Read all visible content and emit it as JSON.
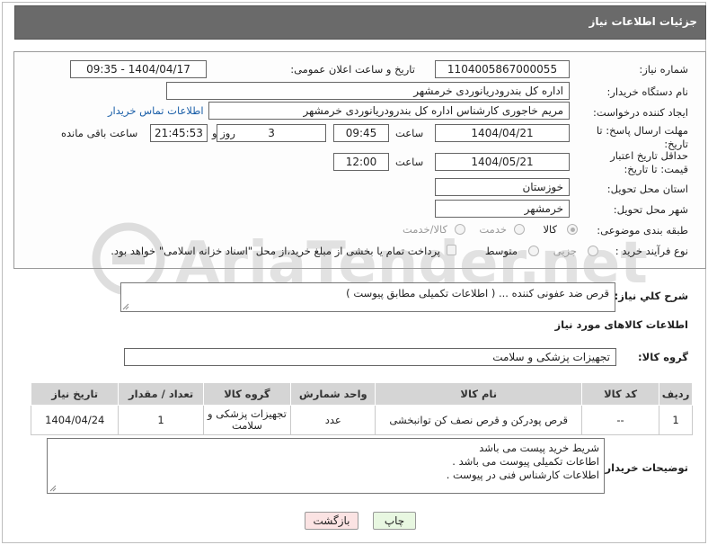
{
  "header": {
    "title": "جزئیات اطلاعات نیاز"
  },
  "labels": {
    "need_number": "شماره نیاز:",
    "announce_datetime": "تاریخ و ساعت اعلان عمومی:",
    "buyer_org": "نام دستگاه خریدار:",
    "requester": "ایجاد کننده درخواست:",
    "contact_link": "اطلاعات تماس خریدار",
    "reply_deadline": "مهلت ارسال پاسخ: تا تاریخ:",
    "hour": "ساعت",
    "day_and": "روز و",
    "hours_remaining": "ساعت باقی مانده",
    "price_validity": "حداقل تاریخ اعتبار قیمت: تا تاریخ:",
    "province": "استان محل تحویل:",
    "city": "شهر محل تحویل:",
    "category": "طبقه بندی موضوعی:",
    "process_type": "نوع فرآیند خرید :",
    "description": "شرح کلي نياز:",
    "goods_info": "اطلاعات کالاهای مورد نیاز",
    "goods_group": "گروه کالا:",
    "buyer_notes": "توضیحات خریدار:"
  },
  "values": {
    "need_number": "1104005867000055",
    "announce_datetime": "1404/04/17 - 09:35",
    "buyer_org": "اداره کل بندرودریانوردی خرمشهر",
    "requester": "مریم خاجوری کارشناس اداره کل بندرودریانوردی خرمشهر",
    "reply_date": "1404/04/21",
    "reply_time": "09:45",
    "remaining_days": "3",
    "remaining_time": "21:45:53",
    "price_date": "1404/05/21",
    "price_time": "12:00",
    "province": "خوزستان",
    "city": "خرمشهر",
    "description": "قرص ضد عفونی کننده ... ( اطلاعات تکمیلی مطابق پیوست )",
    "goods_group": "تجهیزات پزشکی و سلامت"
  },
  "category_options": [
    "کالا",
    "خدمت",
    "کالا/خدمت"
  ],
  "category_selected": "کالا",
  "process_options": [
    "جزیی",
    "متوسط"
  ],
  "payment_note": "پرداخت تمام یا بخشی از مبلغ خرید،از محل \"اسناد خزانه اسلامی\" خواهد بود.",
  "table": {
    "headers": [
      "ردیف",
      "کد کالا",
      "نام کالا",
      "واحد شمارش",
      "گروه کالا",
      "تعداد / مقدار",
      "تاریخ نیاز"
    ],
    "rows": [
      [
        "1",
        "--",
        "قرص پودرکن و قرص نصف کن توانبخشی",
        "عدد",
        "تجهیزات پزشکی و سلامت",
        "1",
        "1404/04/24"
      ]
    ]
  },
  "buyer_notes": [
    "شریط خرید پیست می باشد",
    "اطاعات تکمیلی پیوست می باشد .",
    "اطلاعات کارشناس فنی در پیوست ."
  ],
  "buttons": {
    "print": "چاپ",
    "back": "بازگشت"
  },
  "watermark": "AriaTender.net",
  "colors": {
    "header_bg": "#6a6a6a",
    "link": "#1b5fa8",
    "print_bg": "#e8f7e1",
    "back_bg": "#fbe3e3"
  }
}
